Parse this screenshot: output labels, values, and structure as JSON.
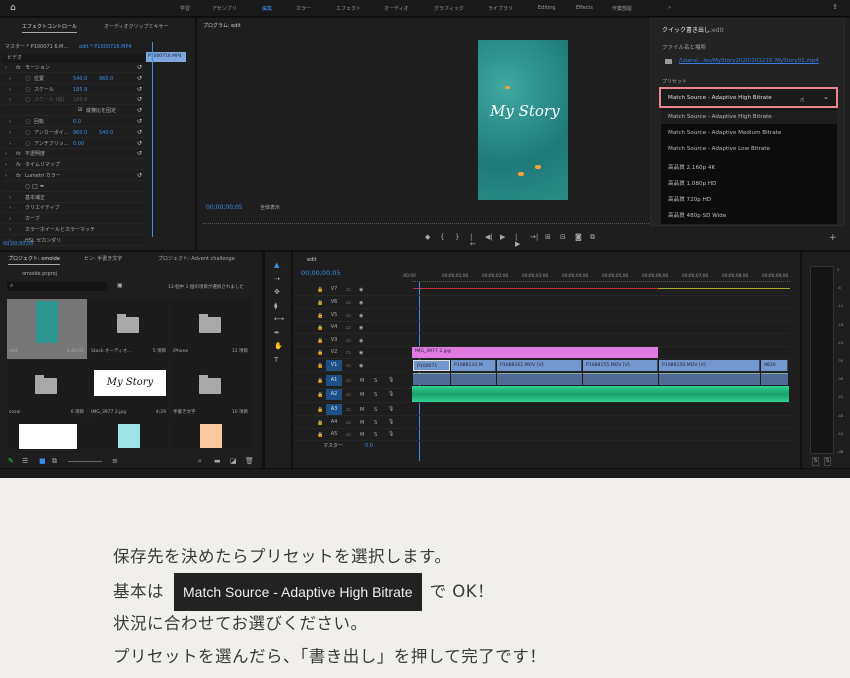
{
  "workspaces": {
    "items": [
      "学習",
      "アセンブリ",
      "編集",
      "カラー",
      "エフェクト",
      "オーディオ",
      "グラフィック",
      "ライブラリ",
      "Editing",
      "Effects",
      "作業部屋"
    ],
    "active": "編集",
    "more": "»"
  },
  "effect_controls": {
    "tabs": [
      "エフェクトコントロール",
      "オーディオクリップミキサー"
    ],
    "master": "マスター * P100071 6.M...",
    "sequence": "edit * P1000716.MP4",
    "mini_clip": "P1000716.MP4",
    "ruler": [
      "00;00",
      "00;00"
    ],
    "section": "ビデオ",
    "rows": [
      {
        "label": "モーション",
        "fx": true,
        "indent": 1
      },
      {
        "label": "位置",
        "v1": "540.0",
        "v2": "960.0",
        "indent": 2,
        "stop": true
      },
      {
        "label": "スケール",
        "v1": "185.9",
        "indent": 2,
        "stop": true
      },
      {
        "label": "スケール (幅)",
        "v1": "185.9",
        "indent": 2,
        "stop": true,
        "dim": true
      },
      {
        "label": "縦横比を固定",
        "indent": 3,
        "check": true
      },
      {
        "label": "回転",
        "v1": "0.0",
        "indent": 2,
        "stop": true
      },
      {
        "label": "アンカーポイ...",
        "v1": "960.0",
        "v2": "540.0",
        "indent": 2,
        "stop": true
      },
      {
        "label": "アンチフリッ...",
        "v1": "0.00",
        "indent": 2,
        "stop": true
      },
      {
        "label": "不透明度",
        "fx": true,
        "indent": 1
      },
      {
        "label": "タイムリマップ",
        "fx": true,
        "indent": 1
      },
      {
        "label": "Lumetri カラー",
        "fx": true,
        "indent": 1
      },
      {
        "label": "",
        "indent": 2,
        "shapes": true
      },
      {
        "label": "基本補正",
        "indent": 2
      },
      {
        "label": "クリエイティブ",
        "indent": 2
      },
      {
        "label": "カーブ",
        "indent": 2
      },
      {
        "label": "カラーホイールとカラーマッチ",
        "indent": 2
      },
      {
        "label": "HSL セカンダリ",
        "indent": 2
      }
    ],
    "timecode": "00;00;00;05"
  },
  "program": {
    "title": "プログラム: edit",
    "timecode": "00;00;00;05",
    "zoom": "全体表示",
    "overlay_text": "My Story"
  },
  "quick_export": {
    "title": "クイック書き出し",
    "title_suffix": "edit",
    "file_label": "ファイル名と場所",
    "file_path": "/Users/...les/MyStory2020/201215_MyStory01.mp4",
    "preset_label": "プリセット",
    "selected": "Match Source - Adaptive High Bitrate",
    "options": [
      "Match Source - Adaptive High Bitrate",
      "Match Source - Adaptive Medium Bitrate",
      "Match Source - Adaptive Low Bitrate",
      "高品質 2,160p 4K",
      "高品質 1,080p HD",
      "高品質 720p HD",
      "高品質 480p SD Wide"
    ],
    "highlight_color": "#e8858f"
  },
  "project": {
    "tabs": [
      "プロジェクト: omoide",
      "ビン: 手書き文字",
      "プロジェクト: Advent challenge"
    ],
    "file": "omoide.prproj",
    "selection_info": "13 個中 1 個の項目が選択されました",
    "items": [
      {
        "name": "edit",
        "meta": "2;40;01",
        "kind": "sequence"
      },
      {
        "name": "Stock オーディオ...",
        "meta": "5 項目",
        "kind": "folder"
      },
      {
        "name": "iPhone",
        "meta": "12 項目",
        "kind": "folder"
      },
      {
        "name": "sozai",
        "meta": "6 項目",
        "kind": "folder"
      },
      {
        "name": "IMG_3977 2.jpg",
        "meta": "4;29",
        "kind": "image"
      },
      {
        "name": "手書き文字",
        "meta": "10 項目",
        "kind": "folder"
      },
      {
        "name": "",
        "meta": "",
        "kind": "drawing"
      },
      {
        "name": "",
        "meta": "",
        "kind": "color",
        "color": "#9ee3e3"
      },
      {
        "name": "",
        "meta": "",
        "kind": "color",
        "color": "#ffc9a0"
      }
    ]
  },
  "timeline": {
    "title": "edit",
    "timecode": "00;00;00;05",
    "ruler": [
      ":00;00",
      "00;00;01;00",
      "00;00;02;00",
      "00;00;03;00",
      "00;00;04;00",
      "00;00;05;00",
      "00;00;06;00",
      "00;00;07;00",
      "00;00;08;00",
      "00;00;09;00"
    ],
    "tracks": [
      "V7",
      "V6",
      "V5",
      "V4",
      "V3",
      "V2",
      "V1",
      "A1",
      "A2",
      "A3",
      "A4",
      "A5"
    ],
    "master_label": "マスター",
    "master_value": "0.0",
    "v2_clip": "IMG_3977 2.jpg",
    "v1_clips": [
      "P100071",
      "P1088134.M",
      "P1088162.MOV [V]",
      "P1088155.MOV [V]",
      "P1088159.MOV [V]",
      "9820"
    ],
    "meter_scale": [
      "0",
      "-6",
      "-12",
      "-18",
      "-24",
      "-30",
      "-36",
      "-42",
      "-48",
      "-54",
      "-dB"
    ],
    "meter_solo": [
      "S",
      "S"
    ]
  },
  "caption": {
    "line1": "保存先を決めたらプリセットを選択します。",
    "line2_pre": "基本は",
    "line2_highlight": "Match Source - Adaptive High Bitrate",
    "line2_post": "で OK！",
    "line3": "状況に合わせてお選びください。",
    "line4": "プリセットを選んだら、「書き出し」を押して完了です！"
  }
}
